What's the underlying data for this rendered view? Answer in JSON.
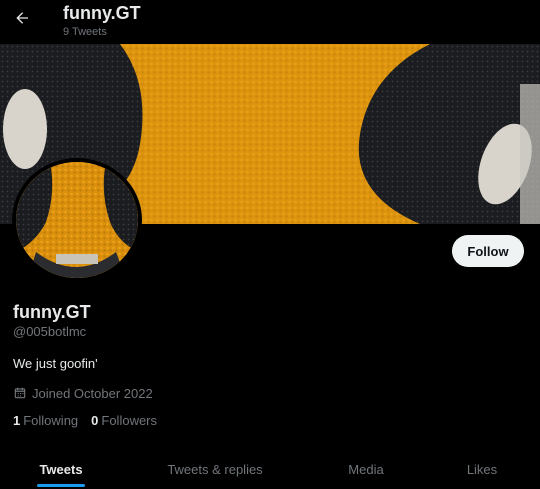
{
  "header": {
    "title": "funny.GT",
    "tweet_count": "9 Tweets"
  },
  "profile": {
    "display_name": "funny.GT",
    "handle": "@005botlmc",
    "bio": "We just goofin'",
    "joined": "Joined October 2022",
    "following_count": "1",
    "following_label": "Following",
    "followers_count": "0",
    "followers_label": "Followers"
  },
  "follow_button": {
    "label": "Follow"
  },
  "tabs": [
    {
      "label": "Tweets",
      "active": true
    },
    {
      "label": "Tweets & replies",
      "active": false
    },
    {
      "label": "Media",
      "active": false
    },
    {
      "label": "Likes",
      "active": false
    }
  ],
  "icons": {
    "back": "arrow-left-icon",
    "joined": "calendar-icon"
  },
  "colors": {
    "background": "#000000",
    "primary_text": "#e7e9ea",
    "secondary_text": "#71767b",
    "accent": "#1d9bf0",
    "follow_button_bg": "#eff3f4"
  }
}
